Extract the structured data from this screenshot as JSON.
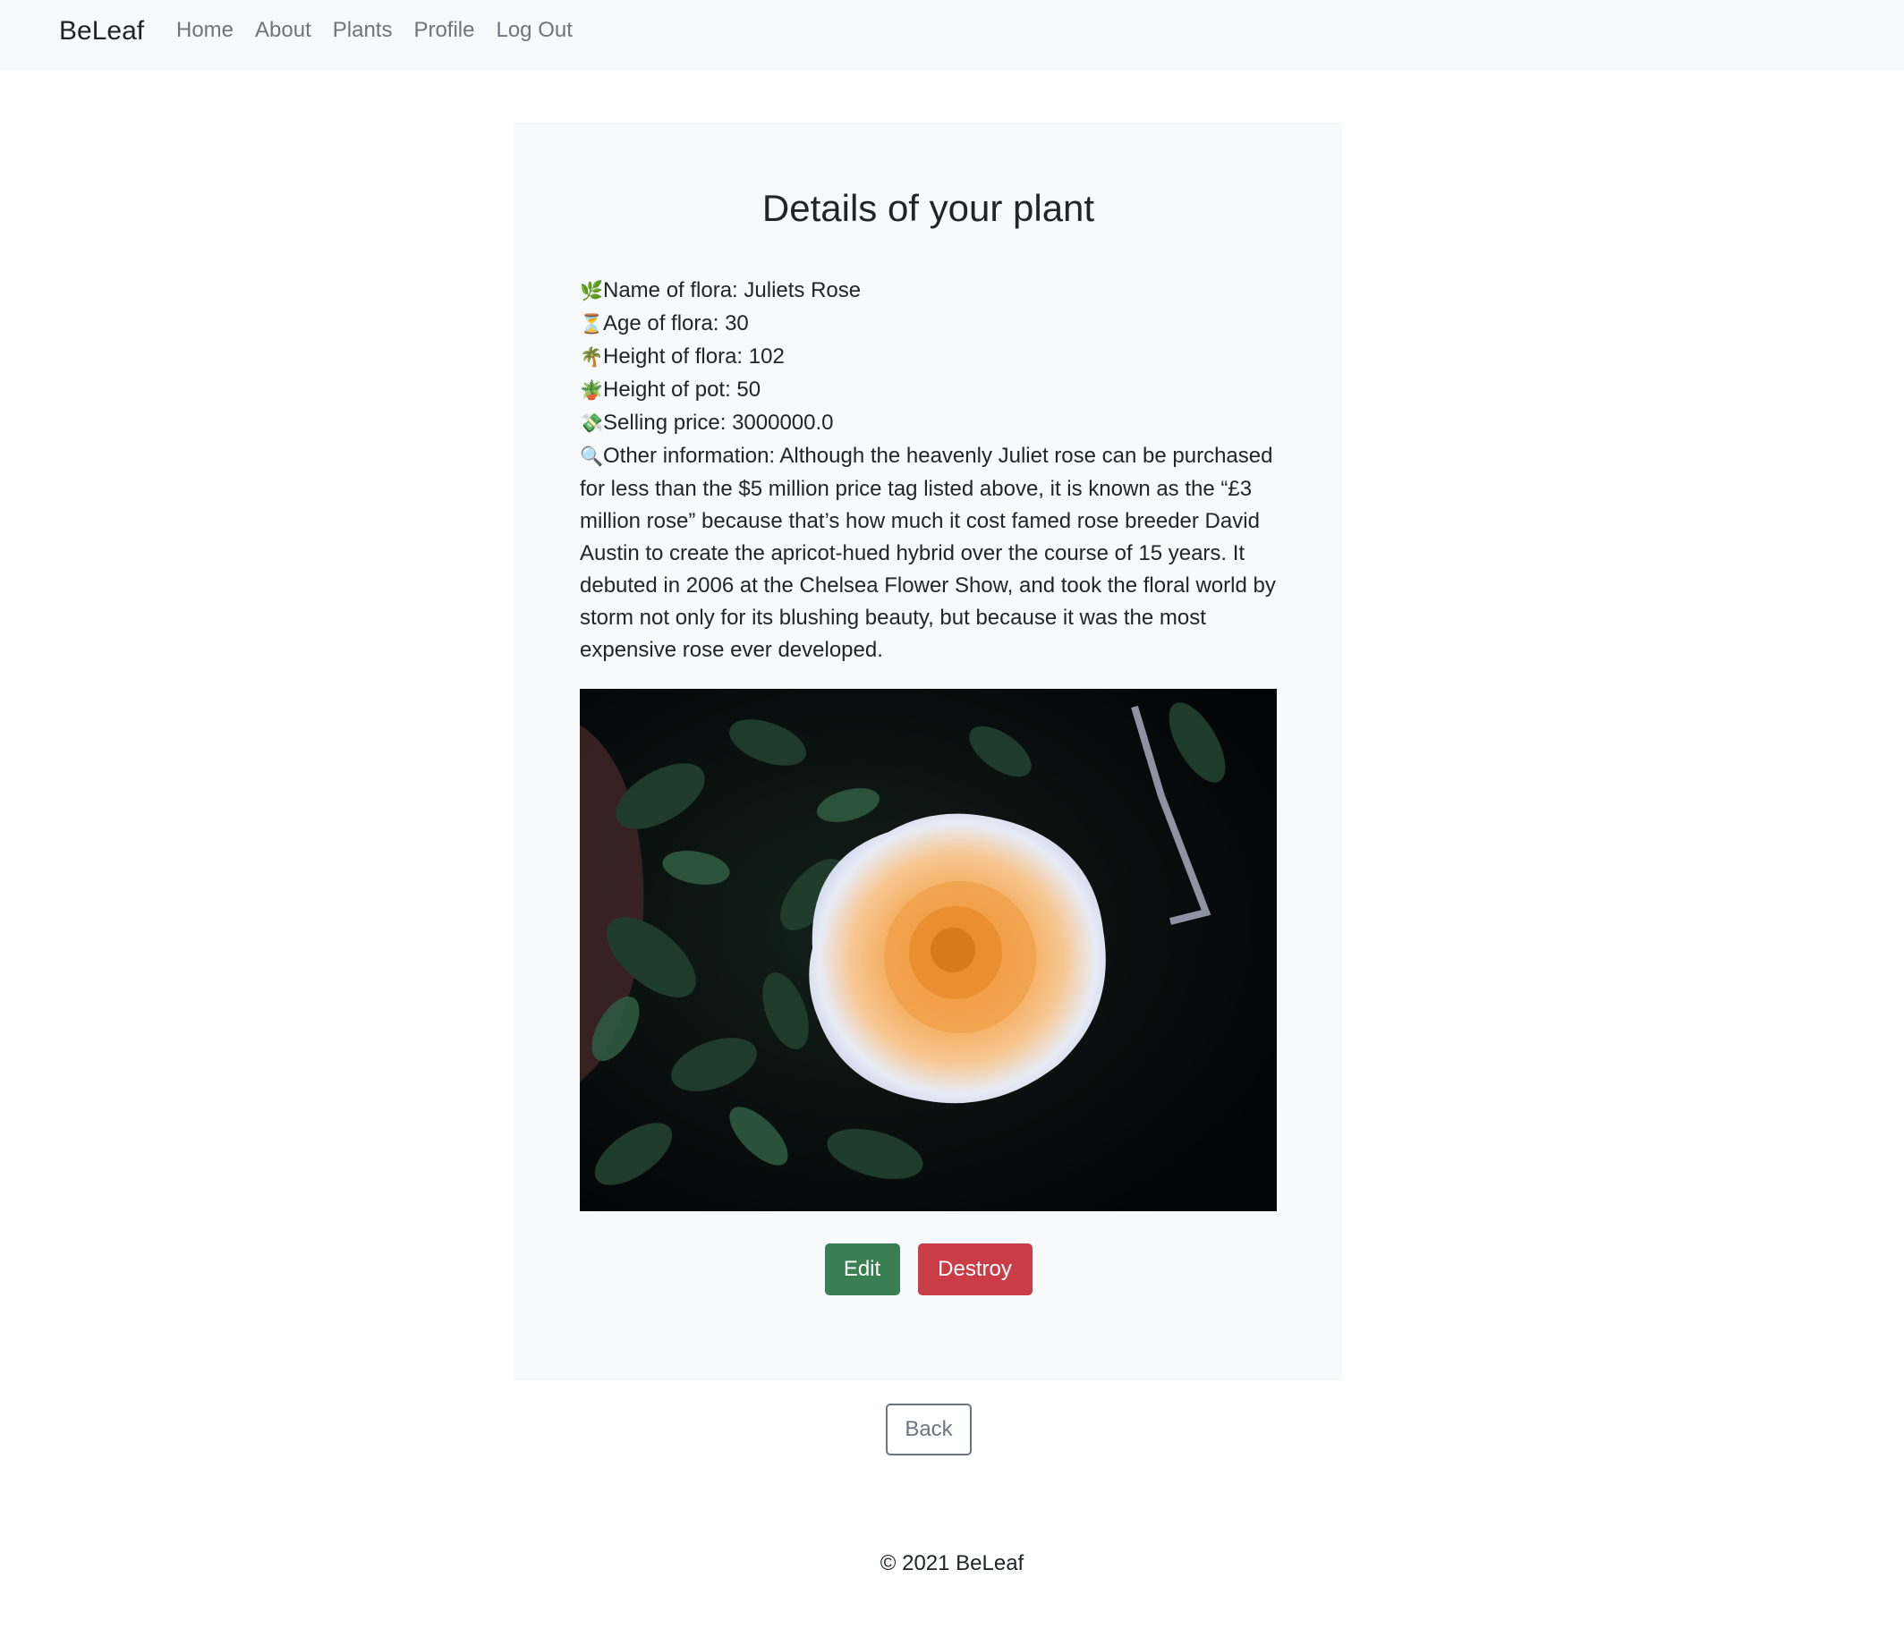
{
  "navbar": {
    "brand": "BeLeaf",
    "links": [
      "Home",
      "About",
      "Plants",
      "Profile",
      "Log Out"
    ]
  },
  "card": {
    "title": "Details of your plant",
    "details": [
      {
        "icon": "herb-icon",
        "glyph": "🌿",
        "text": "Name of flora: Juliets Rose"
      },
      {
        "icon": "hourglass-icon",
        "glyph": "⏳",
        "text": "Age of flora: 30"
      },
      {
        "icon": "palm-tree-icon",
        "glyph": "🌴",
        "text": "Height of flora: 102"
      },
      {
        "icon": "potted-plant-icon",
        "glyph": "🪴",
        "text": "Height of pot: 50"
      },
      {
        "icon": "money-icon",
        "glyph": "💸",
        "text": "Selling price: 3000000.0"
      },
      {
        "icon": "magnifier-icon",
        "glyph": "🔍",
        "text": "Other information: Although the heavenly Juliet rose can be purchased for less than the $5 million price tag listed above, it is known as the “£3 million rose” because that’s how much it cost famed rose breeder David Austin to create the apricot-hued hybrid over the course of 15 years. It debuted in 2006 at the Chelsea Flower Show, and took the floral world by storm not only for its blushing beauty, but because it was the most expensive rose ever developed."
      }
    ],
    "edit_label": "Edit",
    "destroy_label": "Destroy"
  },
  "back_label": "Back",
  "footer": "© 2021 BeLeaf",
  "colors": {
    "edit": "#3a7f53",
    "destroy": "#ca3d47",
    "card_bg": "#f8f9fa"
  }
}
